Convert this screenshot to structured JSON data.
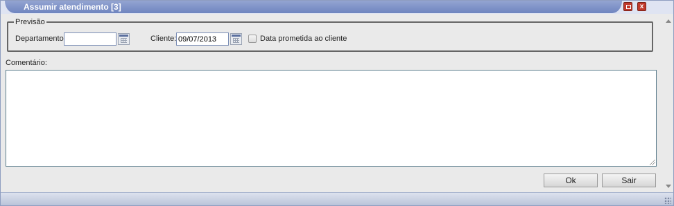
{
  "window": {
    "title": "Assumir atendimento [3]",
    "maximize_label": "",
    "close_label": "x"
  },
  "previsao": {
    "legend": "Previsão",
    "departamento_label": "Departamento:",
    "departamento_value": "",
    "cliente_label": "Cliente:",
    "cliente_value": "09/07/2013",
    "checkbox_label": "Data prometida ao cliente",
    "checkbox_checked": false
  },
  "comentario": {
    "label": "Comentário:",
    "value": ""
  },
  "actions": {
    "ok_label": "Ok",
    "sair_label": "Sair"
  },
  "colors": {
    "title_bar": "#7f93c9",
    "close_button": "#c0392b"
  }
}
